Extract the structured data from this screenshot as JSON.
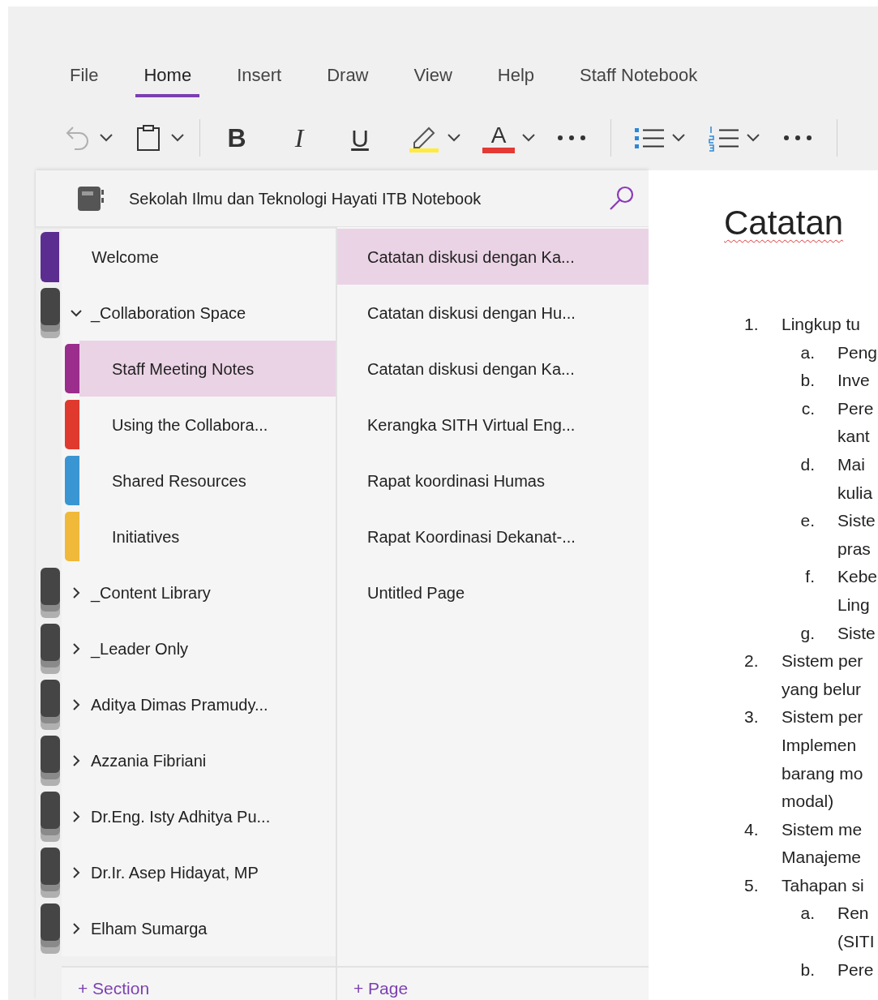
{
  "menu": {
    "tabs": [
      {
        "label": "File",
        "selected": false
      },
      {
        "label": "Home",
        "selected": true
      },
      {
        "label": "Insert",
        "selected": false
      },
      {
        "label": "Draw",
        "selected": false
      },
      {
        "label": "View",
        "selected": false
      },
      {
        "label": "Help",
        "selected": false
      },
      {
        "label": "Staff Notebook",
        "selected": false
      }
    ]
  },
  "toolbar": {
    "undo": {
      "disabled": true
    },
    "bold": "B",
    "italic": "I",
    "underline": "U",
    "font_color": {
      "label": "A",
      "color": "#e53935"
    },
    "highlight": {
      "color": "#ffeb3b"
    }
  },
  "notebook": {
    "title": "Sekolah Ilmu dan Teknologi Hayati ITB Notebook"
  },
  "sections": [
    {
      "kind": "section",
      "label": "Welcome",
      "color": "#5c2d91",
      "selected": false
    },
    {
      "kind": "group",
      "label": "_Collaboration Space",
      "expanded": true,
      "children": [
        {
          "kind": "section",
          "label": "Staff Meeting Notes",
          "color": "#9b2d8c",
          "selected": true
        },
        {
          "kind": "section",
          "label": "Using the Collabora...",
          "color": "#e03a2f",
          "selected": false
        },
        {
          "kind": "section",
          "label": "Shared Resources",
          "color": "#3a96d3",
          "selected": false
        },
        {
          "kind": "section",
          "label": "Initiatives",
          "color": "#f0b93a",
          "selected": false
        }
      ]
    },
    {
      "kind": "group",
      "label": "_Content Library",
      "expanded": false
    },
    {
      "kind": "group",
      "label": "_Leader Only",
      "expanded": false
    },
    {
      "kind": "group",
      "label": "Aditya Dimas Pramudy...",
      "expanded": false
    },
    {
      "kind": "group",
      "label": "Azzania Fibriani",
      "expanded": false
    },
    {
      "kind": "group",
      "label": "Dr.Eng. Isty Adhitya Pu...",
      "expanded": false
    },
    {
      "kind": "group",
      "label": "Dr.Ir. Asep Hidayat, MP",
      "expanded": false
    },
    {
      "kind": "group",
      "label": "Elham Sumarga",
      "expanded": false
    }
  ],
  "add_section": "+ Section",
  "pages": [
    {
      "label": "Catatan diskusi dengan Ka...",
      "selected": true
    },
    {
      "label": "Catatan diskusi dengan Hu...",
      "selected": false
    },
    {
      "label": "Catatan diskusi dengan Ka...",
      "selected": false
    },
    {
      "label": "Kerangka SITH Virtual Eng...",
      "selected": false
    },
    {
      "label": "Rapat koordinasi Humas",
      "selected": false
    },
    {
      "label": "Rapat Koordinasi Dekanat-...",
      "selected": false
    },
    {
      "label": "Untitled Page",
      "selected": false
    }
  ],
  "add_page": "+ Page",
  "page": {
    "title": "Catatan",
    "list": [
      {
        "marker": "1.",
        "lines": [
          "Lingkup tu"
        ],
        "children": [
          {
            "marker": "a.",
            "lines": [
              "Peng"
            ]
          },
          {
            "marker": "b.",
            "lines": [
              "Inve"
            ]
          },
          {
            "marker": "c.",
            "lines": [
              "Pere",
              "kant"
            ]
          },
          {
            "marker": "d.",
            "lines": [
              "Mai",
              "kulia"
            ]
          },
          {
            "marker": "e.",
            "lines": [
              "Siste",
              "pras"
            ]
          },
          {
            "marker": "f.",
            "lines": [
              "Kebe",
              "Ling"
            ]
          },
          {
            "marker": "g.",
            "lines": [
              "Siste"
            ]
          }
        ]
      },
      {
        "marker": "2.",
        "lines": [
          "Sistem per",
          "yang belur"
        ]
      },
      {
        "marker": "3.",
        "lines": [
          "Sistem per",
          "Implemen",
          "barang mo",
          "modal)"
        ]
      },
      {
        "marker": "4.",
        "lines": [
          "Sistem me",
          "Manajeme"
        ]
      },
      {
        "marker": "5.",
        "lines": [
          "Tahapan si"
        ],
        "children": [
          {
            "marker": "a.",
            "lines": [
              "Ren",
              "(SITI"
            ]
          },
          {
            "marker": "b.",
            "lines": [
              "Pere"
            ]
          }
        ]
      }
    ]
  }
}
